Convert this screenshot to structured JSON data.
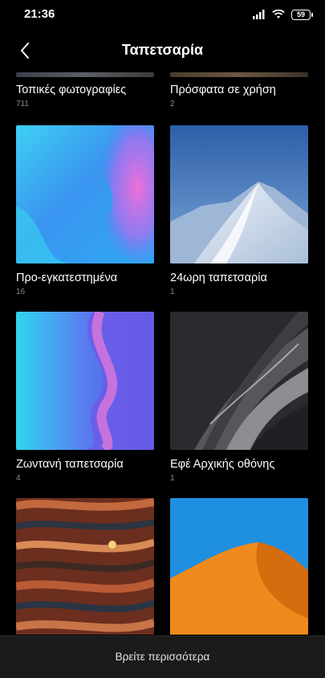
{
  "status_bar": {
    "time": "21:36",
    "battery": "59"
  },
  "header": {
    "title": "Ταπετσαρία"
  },
  "categories": [
    {
      "label": "Τοπικές φωτογραφίες",
      "count": "711"
    },
    {
      "label": "Πρόσφατα σε χρήση",
      "count": "2"
    },
    {
      "label": "Προ-εγκατεστημένα",
      "count": "16"
    },
    {
      "label": "24ωρη ταπετσαρία",
      "count": "1"
    },
    {
      "label": "Ζωντανή ταπετσαρία",
      "count": "4"
    },
    {
      "label": "Εφέ Αρχικής οθόνης",
      "count": "1"
    }
  ],
  "footer": {
    "find_more": "Βρείτε περισσότερα"
  }
}
